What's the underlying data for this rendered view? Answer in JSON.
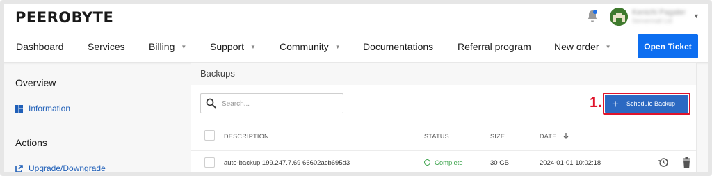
{
  "brand": {
    "logo_text": "PEEROBYTE"
  },
  "user": {
    "name": "Kenichi Pagaler",
    "subtitle": "Servermall Ltd"
  },
  "icons": {
    "bell": "bell-icon",
    "avatar": "avatar-image",
    "search": "search-icon",
    "plus": "plus-icon",
    "restore": "restore-icon",
    "delete": "trash-icon",
    "info": "dashboard-grid-icon",
    "external": "external-link-icon",
    "sort": "arrow-down-icon"
  },
  "nav": {
    "items": [
      {
        "label": "Dashboard",
        "dropdown": false
      },
      {
        "label": "Services",
        "dropdown": false
      },
      {
        "label": "Billing",
        "dropdown": true
      },
      {
        "label": "Support",
        "dropdown": true
      },
      {
        "label": "Community",
        "dropdown": true
      },
      {
        "label": "Documentations",
        "dropdown": false
      },
      {
        "label": "Referral program",
        "dropdown": false
      },
      {
        "label": "New order",
        "dropdown": true
      }
    ],
    "open_ticket": "Open Ticket",
    "caret": "▼"
  },
  "sidebar": {
    "overview_heading": "Overview",
    "information_link": "Information",
    "actions_heading": "Actions",
    "upgrade_link": "Upgrade/Downgrade"
  },
  "backups": {
    "title": "Backups",
    "search_placeholder": "Search...",
    "step_marker": "1.",
    "schedule_button": "Schedule Backup",
    "plus_glyph": "+",
    "columns": {
      "description": "DESCRIPTION",
      "status": "STATUS",
      "size": "SIZE",
      "date": "DATE"
    },
    "rows": [
      {
        "description": "auto-backup 199.247.7.69 66602acb695d3",
        "status": "Complete",
        "size": "30 GB",
        "date": "2024-01-01 10:02:18"
      }
    ]
  },
  "colors": {
    "primary": "#0d6ef0",
    "schedule_bg": "#2c69c2",
    "highlight_red": "#e0142b",
    "status_green": "#3aa34a",
    "link_blue": "#1f5fb8"
  }
}
